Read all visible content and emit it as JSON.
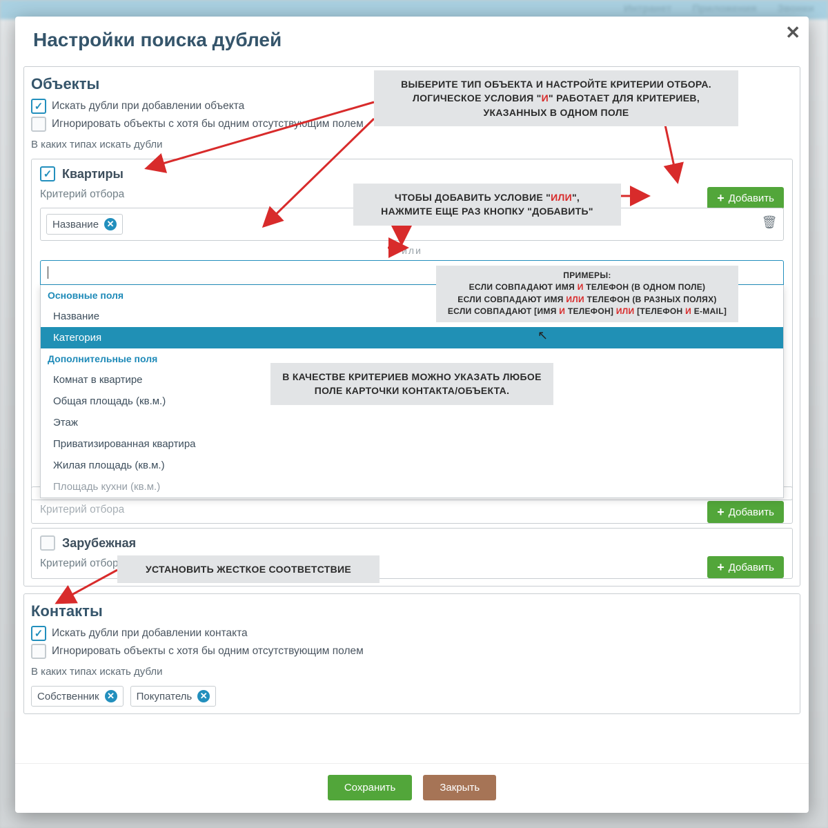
{
  "modal": {
    "title": "Настройки поиска дублей",
    "close": "✕"
  },
  "objects": {
    "heading": "Объекты",
    "chk1_label": "Искать дубли при добавлении объекта",
    "chk2_label": "Игнорировать объекты с хотя бы одним отсутствующим полем",
    "types_label": "В каких типах искать дубли"
  },
  "apartments": {
    "title": "Квартиры",
    "criteria_label": "Критерий отбора",
    "add_button": "Добавить",
    "chip_name": "Название",
    "or_label": "или"
  },
  "dropdown": {
    "group1": "Основные поля",
    "item_name": "Название",
    "item_category": "Категория",
    "group2": "Дополнительные поля",
    "item_rooms": "Комнат в квартире",
    "item_total_area": "Общая площадь (кв.м.)",
    "item_floor": "Этаж",
    "item_privatized": "Приватизированная квартира",
    "item_living_area": "Жилая площадь (кв.м.)",
    "item_kitchen_area": "Площадь кухни (кв.м.)"
  },
  "faded_block": {
    "criteria_label": "Критерий отбора",
    "add_button": "Добавить"
  },
  "foreign": {
    "title": "Зарубежная",
    "criteria_label": "Критерий отбора",
    "add_button": "Добавить"
  },
  "contacts": {
    "heading": "Контакты",
    "chk1_label": "Искать дубли при добавлении контакта",
    "chk2_label": "Игнорировать объекты с хотя бы одним отсутствующим полем",
    "types_label": "В каких типах искать дубли",
    "chip_owner": "Собственник",
    "chip_buyer": "Покупатель"
  },
  "footer": {
    "save": "Сохранить",
    "close": "Закрыть"
  },
  "callouts": {
    "c1_a": "ВЫБЕРИТЕ ТИП ОБЪЕКТА И НАСТРОЙТЕ КРИТЕРИИ ОТБОРА.",
    "c1_b1": "ЛОГИЧЕСКОЕ УСЛОВИЯ \"",
    "c1_b_red": "И",
    "c1_b2": "\" РАБОТАЕТ ДЛЯ КРИТЕРИЕВ,",
    "c1_c": "УКАЗАННЫХ В ОДНОМ ПОЛЕ",
    "c2_a1": "ЧТОБЫ ДОБАВИТЬ УСЛОВИЕ  \"",
    "c2_a_red": "ИЛИ",
    "c2_a2": "\",",
    "c2_b": "НАЖМИТЕ ЕЩЕ РАЗ КНОПКУ \"ДОБАВИТЬ\"",
    "c3_h": "ПРИМЕРЫ:",
    "c3_l1a": "ЕСЛИ СОВПАДАЮТ ИМЯ ",
    "c3_l1r": "И",
    "c3_l1b": " ТЕЛЕФОН (В ОДНОМ ПОЛЕ)",
    "c3_l2a": "ЕСЛИ СОВПАДАЮТ ИМЯ ",
    "c3_l2r": "ИЛИ",
    "c3_l2b": " ТЕЛЕФОН (В РАЗНЫХ ПОЛЯХ)",
    "c3_l3a": "ЕСЛИ СОВПАДАЮТ [ИМЯ ",
    "c3_l3r1": "И",
    "c3_l3b": " ТЕЛЕФОН] ",
    "c3_l3r2": "ИЛИ",
    "c3_l3c": " [ТЕЛЕФОН ",
    "c3_l3r3": "И",
    "c3_l3d": " E-MAIL]",
    "c4": "В КАЧЕСТВЕ КРИТЕРИЕВ МОЖНО УКАЗАТЬ ЛЮБОЕ ПОЛЕ КАРТОЧКИ КОНТАКТА/ОБЪЕКТА.",
    "c5": "УСТАНОВИТЬ ЖЕСТКОЕ СООТВЕТСТВИЕ"
  },
  "bg": {
    "nav1": "Интранет",
    "nav2": "Приложения",
    "nav3": "Звонки"
  }
}
